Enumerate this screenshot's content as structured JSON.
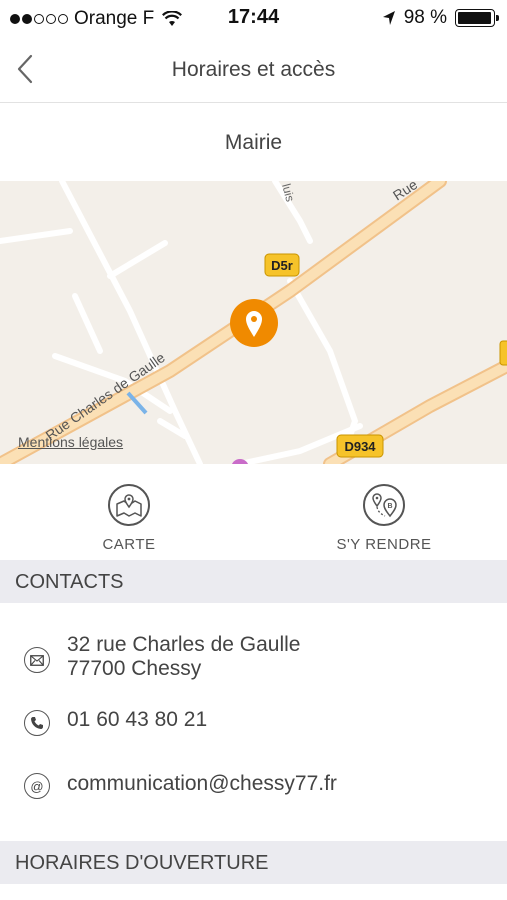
{
  "status_bar": {
    "carrier": "Orange F",
    "time": "17:44",
    "battery": "98 %",
    "battery_level": 0.98,
    "signal_bars_filled": 2,
    "signal_bars_total": 5
  },
  "nav": {
    "title": "Horaires et accès",
    "back_icon": "chevron-left-icon"
  },
  "place": {
    "name": "Mairie"
  },
  "map": {
    "legal_link": "Mentions légales",
    "street_label": "Rue Charles de Gaulle",
    "street_label_short": "Rue",
    "street_fragment": "luis",
    "route_badges": [
      "D5r",
      "D934"
    ],
    "marker_icon": "location-pin-icon",
    "road_color": "#fbd9a2",
    "badge_color": "#f6c32a",
    "marker_color": "#f08a00"
  },
  "actions": {
    "carte": {
      "label": "CARTE",
      "icon": "map-icon"
    },
    "route": {
      "label": "S'Y RENDRE",
      "icon": "directions-icon"
    }
  },
  "contacts": {
    "header": "CONTACTS",
    "address_line1": "32 rue Charles de Gaulle",
    "address_line2": "77700 Chessy",
    "phone": "01 60 43 80 21",
    "email": "communication@chessy77.fr"
  },
  "hours": {
    "header": "HORAIRES D'OUVERTURE"
  }
}
